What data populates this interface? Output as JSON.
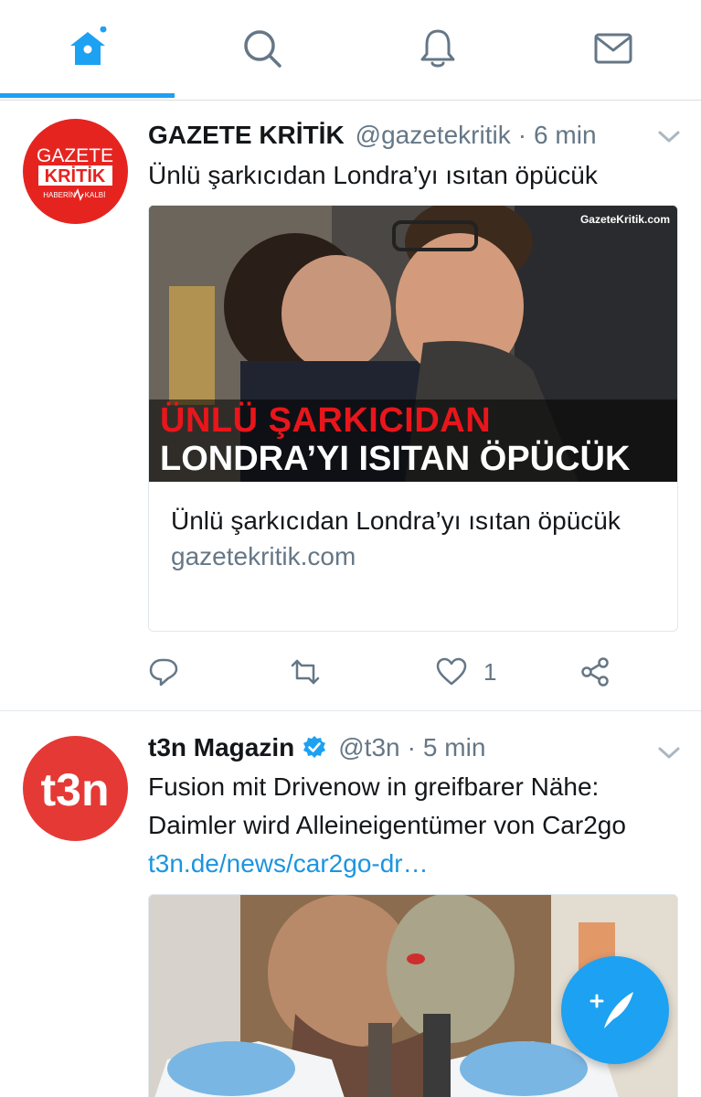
{
  "nav": {
    "tabs": [
      {
        "name": "home",
        "icon": "home-icon",
        "active": true
      },
      {
        "name": "search",
        "icon": "search-icon",
        "active": false
      },
      {
        "name": "notifications",
        "icon": "bell-icon",
        "active": false
      },
      {
        "name": "messages",
        "icon": "envelope-icon",
        "active": false
      }
    ]
  },
  "colors": {
    "accent": "#1da1f2",
    "link": "#1b95e0",
    "muted": "#657786"
  },
  "tweets": [
    {
      "name": "GAZETE KRİTİK",
      "handle": "@gazetekritik",
      "dot": "·",
      "time": "6 min",
      "text": "Ünlü şarkıcıdan Londra’yı ısıtan öpücük",
      "avatar_logo": {
        "line1": "GAZETE",
        "line2": "KRİTİK",
        "tagline_left": "HABERİN",
        "tagline_right": "KALBİ"
      },
      "image": {
        "watermark": "GazeteKritik.com",
        "headline_red": "ÜNLÜ ŞARKICIDAN",
        "headline_white": "LONDRA’YI ISITAN ÖPÜCÜK"
      },
      "card": {
        "title": "Ünlü şarkıcıdan Londra’yı ısıtan öpücük",
        "domain": "gazetekritik.com"
      },
      "actions": {
        "reply": "",
        "retweet": "",
        "like": "1",
        "share": ""
      }
    },
    {
      "name": "t3n Magazin",
      "handle": "@t3n",
      "dot": "·",
      "time": "5 min",
      "verified": true,
      "text": "Fusion mit Drivenow in greifbarer Nähe: Daimler wird Alleineigentümer von Car2go",
      "text_plain": "Fusion mit Drivenow in greifbarer Nähe: Daimler wird Alleineigentümer von Car2go ",
      "link": "t3n.de/news/car2go-dr…",
      "avatar_logo": {
        "text": "t3n"
      }
    }
  ],
  "fab": {
    "icon": "compose-tweet-icon"
  }
}
